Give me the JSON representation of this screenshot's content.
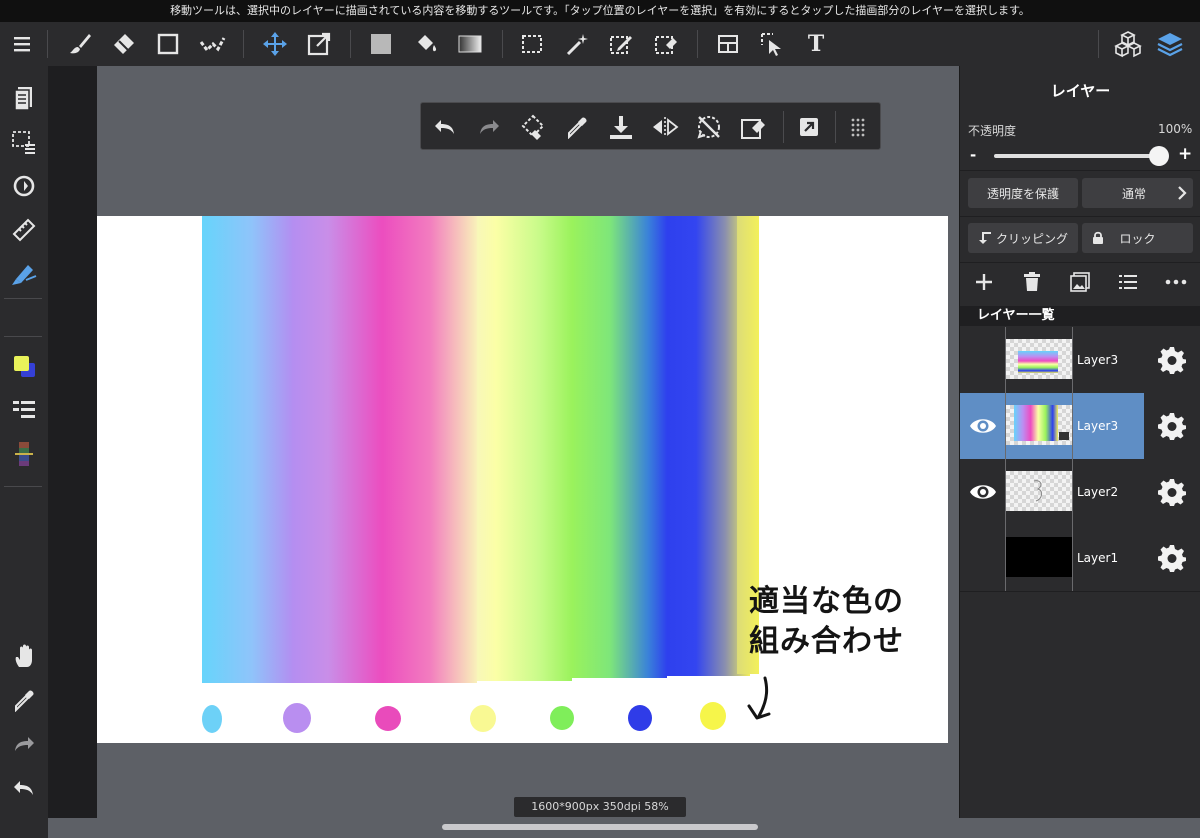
{
  "hint": "移動ツールは、選択中のレイヤーに描画されている内容を移動するツールです。「タップ位置のレイヤーを選択」を有効にするとタップした描画部分のレイヤーを選択します。",
  "toolbar": {
    "tools": [
      "menu-icon",
      "brush-icon",
      "eraser-icon",
      "shape-icon",
      "dot-brush-icon",
      "move-icon",
      "transform-icon",
      "fill-rect-icon",
      "bucket-icon",
      "gradient-icon",
      "select-rect-icon",
      "magic-wand-icon",
      "select-pen-icon",
      "select-eraser-icon",
      "frame-icon",
      "operation-icon",
      "text-icon",
      "materials-icon",
      "layers-icon"
    ],
    "active_tool": "move-icon",
    "text_tool_label": "T"
  },
  "float_toolbar": {
    "tools": [
      "undo-icon",
      "redo-icon",
      "lasso-icon",
      "eyedropper-icon",
      "download-icon",
      "flip-icon",
      "rotate-icon",
      "clear-icon",
      "export-icon",
      "grip-icon"
    ]
  },
  "left_tools": [
    "pages-icon",
    "selection-icon",
    "rotate-view-icon",
    "ruler-icon",
    "pen-snap-icon",
    "color-icon",
    "layer-list-icon",
    "palette-icon",
    "hand-icon",
    "eyedropper-icon",
    "redo-icon",
    "undo-icon"
  ],
  "colors": {
    "foreground": "#e9f25a",
    "background": "#3540d6",
    "accent": "#5f8ec5"
  },
  "canvas": {
    "bands": [
      "#68d3fb",
      "#bb8ff2",
      "#ee4cc1",
      "#fbffa6",
      "#9af25c",
      "#2e40ee",
      "#f3f05a"
    ],
    "swatches": [
      "#6dd1f7",
      "#b98ef0",
      "#e94bbb",
      "#f9f993",
      "#7fee5a",
      "#2f3ce8",
      "#f6f54a"
    ],
    "note_line1": "適当な色の",
    "note_line2": "組み合わせ"
  },
  "status": {
    "info": "1600*900px 350dpi 58%"
  },
  "panel": {
    "title": "レイヤー",
    "opacity_label": "不透明度",
    "opacity_value": "100%",
    "opacity_level": 1.0,
    "slider_minus": "-",
    "slider_plus": "+",
    "protect_alpha": "透明度を保護",
    "blend_mode": "通常",
    "clipping": "クリッピング",
    "lock": "ロック",
    "list_title": "レイヤー一覧",
    "layers": [
      {
        "name": "Layer3",
        "visible": false,
        "selected": false
      },
      {
        "name": "Layer3",
        "visible": true,
        "selected": true
      },
      {
        "name": "Layer2",
        "visible": true,
        "selected": false
      },
      {
        "name": "Layer1",
        "visible": false,
        "selected": false
      }
    ]
  }
}
